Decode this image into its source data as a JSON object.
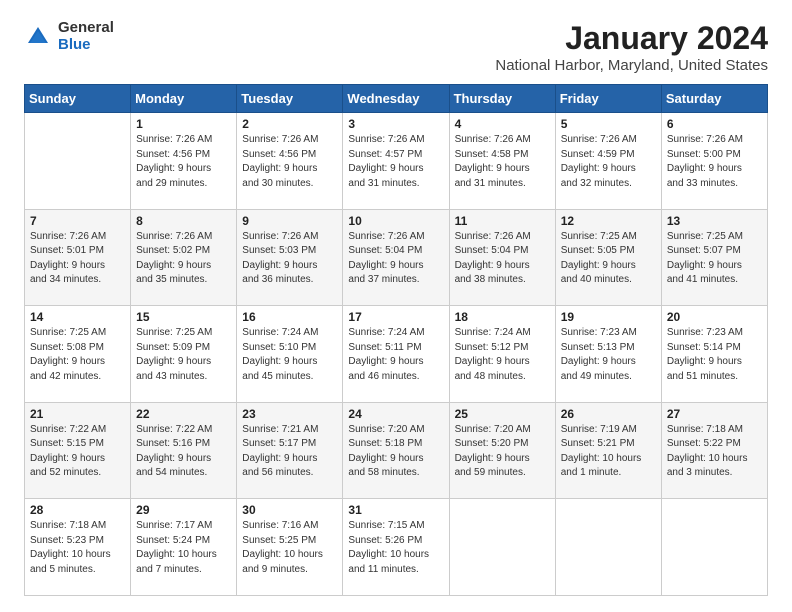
{
  "logo": {
    "general": "General",
    "blue": "Blue"
  },
  "title": "January 2024",
  "subtitle": "National Harbor, Maryland, United States",
  "header_days": [
    "Sunday",
    "Monday",
    "Tuesday",
    "Wednesday",
    "Thursday",
    "Friday",
    "Saturday"
  ],
  "weeks": [
    [
      {
        "day": "",
        "info": ""
      },
      {
        "day": "1",
        "info": "Sunrise: 7:26 AM\nSunset: 4:56 PM\nDaylight: 9 hours\nand 29 minutes."
      },
      {
        "day": "2",
        "info": "Sunrise: 7:26 AM\nSunset: 4:56 PM\nDaylight: 9 hours\nand 30 minutes."
      },
      {
        "day": "3",
        "info": "Sunrise: 7:26 AM\nSunset: 4:57 PM\nDaylight: 9 hours\nand 31 minutes."
      },
      {
        "day": "4",
        "info": "Sunrise: 7:26 AM\nSunset: 4:58 PM\nDaylight: 9 hours\nand 31 minutes."
      },
      {
        "day": "5",
        "info": "Sunrise: 7:26 AM\nSunset: 4:59 PM\nDaylight: 9 hours\nand 32 minutes."
      },
      {
        "day": "6",
        "info": "Sunrise: 7:26 AM\nSunset: 5:00 PM\nDaylight: 9 hours\nand 33 minutes."
      }
    ],
    [
      {
        "day": "7",
        "info": "Sunrise: 7:26 AM\nSunset: 5:01 PM\nDaylight: 9 hours\nand 34 minutes."
      },
      {
        "day": "8",
        "info": "Sunrise: 7:26 AM\nSunset: 5:02 PM\nDaylight: 9 hours\nand 35 minutes."
      },
      {
        "day": "9",
        "info": "Sunrise: 7:26 AM\nSunset: 5:03 PM\nDaylight: 9 hours\nand 36 minutes."
      },
      {
        "day": "10",
        "info": "Sunrise: 7:26 AM\nSunset: 5:04 PM\nDaylight: 9 hours\nand 37 minutes."
      },
      {
        "day": "11",
        "info": "Sunrise: 7:26 AM\nSunset: 5:04 PM\nDaylight: 9 hours\nand 38 minutes."
      },
      {
        "day": "12",
        "info": "Sunrise: 7:25 AM\nSunset: 5:05 PM\nDaylight: 9 hours\nand 40 minutes."
      },
      {
        "day": "13",
        "info": "Sunrise: 7:25 AM\nSunset: 5:07 PM\nDaylight: 9 hours\nand 41 minutes."
      }
    ],
    [
      {
        "day": "14",
        "info": "Sunrise: 7:25 AM\nSunset: 5:08 PM\nDaylight: 9 hours\nand 42 minutes."
      },
      {
        "day": "15",
        "info": "Sunrise: 7:25 AM\nSunset: 5:09 PM\nDaylight: 9 hours\nand 43 minutes."
      },
      {
        "day": "16",
        "info": "Sunrise: 7:24 AM\nSunset: 5:10 PM\nDaylight: 9 hours\nand 45 minutes."
      },
      {
        "day": "17",
        "info": "Sunrise: 7:24 AM\nSunset: 5:11 PM\nDaylight: 9 hours\nand 46 minutes."
      },
      {
        "day": "18",
        "info": "Sunrise: 7:24 AM\nSunset: 5:12 PM\nDaylight: 9 hours\nand 48 minutes."
      },
      {
        "day": "19",
        "info": "Sunrise: 7:23 AM\nSunset: 5:13 PM\nDaylight: 9 hours\nand 49 minutes."
      },
      {
        "day": "20",
        "info": "Sunrise: 7:23 AM\nSunset: 5:14 PM\nDaylight: 9 hours\nand 51 minutes."
      }
    ],
    [
      {
        "day": "21",
        "info": "Sunrise: 7:22 AM\nSunset: 5:15 PM\nDaylight: 9 hours\nand 52 minutes."
      },
      {
        "day": "22",
        "info": "Sunrise: 7:22 AM\nSunset: 5:16 PM\nDaylight: 9 hours\nand 54 minutes."
      },
      {
        "day": "23",
        "info": "Sunrise: 7:21 AM\nSunset: 5:17 PM\nDaylight: 9 hours\nand 56 minutes."
      },
      {
        "day": "24",
        "info": "Sunrise: 7:20 AM\nSunset: 5:18 PM\nDaylight: 9 hours\nand 58 minutes."
      },
      {
        "day": "25",
        "info": "Sunrise: 7:20 AM\nSunset: 5:20 PM\nDaylight: 9 hours\nand 59 minutes."
      },
      {
        "day": "26",
        "info": "Sunrise: 7:19 AM\nSunset: 5:21 PM\nDaylight: 10 hours\nand 1 minute."
      },
      {
        "day": "27",
        "info": "Sunrise: 7:18 AM\nSunset: 5:22 PM\nDaylight: 10 hours\nand 3 minutes."
      }
    ],
    [
      {
        "day": "28",
        "info": "Sunrise: 7:18 AM\nSunset: 5:23 PM\nDaylight: 10 hours\nand 5 minutes."
      },
      {
        "day": "29",
        "info": "Sunrise: 7:17 AM\nSunset: 5:24 PM\nDaylight: 10 hours\nand 7 minutes."
      },
      {
        "day": "30",
        "info": "Sunrise: 7:16 AM\nSunset: 5:25 PM\nDaylight: 10 hours\nand 9 minutes."
      },
      {
        "day": "31",
        "info": "Sunrise: 7:15 AM\nSunset: 5:26 PM\nDaylight: 10 hours\nand 11 minutes."
      },
      {
        "day": "",
        "info": ""
      },
      {
        "day": "",
        "info": ""
      },
      {
        "day": "",
        "info": ""
      }
    ]
  ]
}
